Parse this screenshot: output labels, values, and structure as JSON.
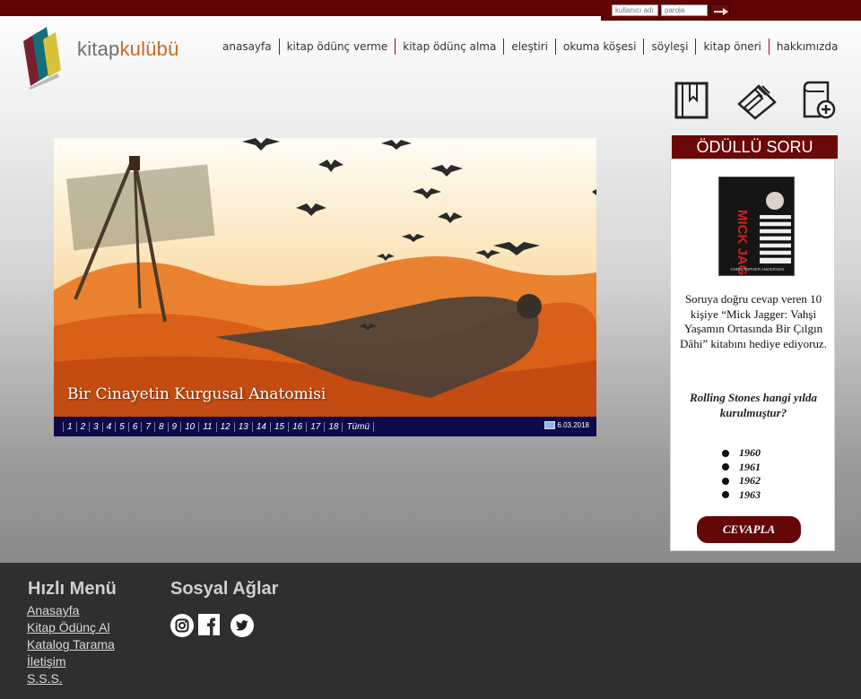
{
  "header": {
    "login": {
      "username_placeholder": "kullanıcı adı",
      "password_placeholder": "parola"
    },
    "logo": {
      "part1": "kitap",
      "part2": "kulübü"
    },
    "nav": [
      "anasayfa",
      "kitap ödünç verme",
      "kitap ödünç alma",
      "eleştiri",
      "okuma köşesi",
      "söyleşi",
      "kitap öneri",
      "hakkımızda"
    ],
    "tools": [
      "book-icon",
      "notebook-pencil-icon",
      "add-book-icon"
    ]
  },
  "slider": {
    "caption": "Bir Cinayetin Kurgusal Anatomisi",
    "pages": [
      "1",
      "2",
      "3",
      "4",
      "5",
      "6",
      "7",
      "8",
      "9",
      "10",
      "11",
      "12",
      "13",
      "14",
      "15",
      "16",
      "17",
      "18",
      "Tümü"
    ],
    "date": "6.03.2018"
  },
  "quiz": {
    "title": "ÖDÜLLÜ SORU",
    "cover_title": "MICK JAGGER",
    "cover_author": "CHRISTOPHER ANDERSEN",
    "text": "Soruya doğru cevap veren 10 kişiye “Mick Jagger: Vahşi Yaşamın Ortasında Bir Çılgın Dâhi” kitabını hediye ediyoruz.",
    "question": "Rolling Stones hangi yılda kurulmuştur?",
    "options": [
      "1960",
      "1961",
      "1962",
      "1963"
    ],
    "answer_label": "CEVAPLA"
  },
  "footer": {
    "quick_menu_title": "Hızlı Menü",
    "quick_menu": [
      "Anasayfa",
      "Kitap Ödünç Al",
      "Katalog Tarama",
      "İletişim",
      "S.S.S."
    ],
    "social_title": "Sosyal Ağlar",
    "social": [
      "instagram-icon",
      "facebook-icon",
      "twitter-icon"
    ]
  },
  "colors": {
    "brand_dark_red": "#5f0505",
    "logo_orange": "#c96a24",
    "footer_bg": "#2f2f2f",
    "slider_bar": "#0d0a4a"
  }
}
